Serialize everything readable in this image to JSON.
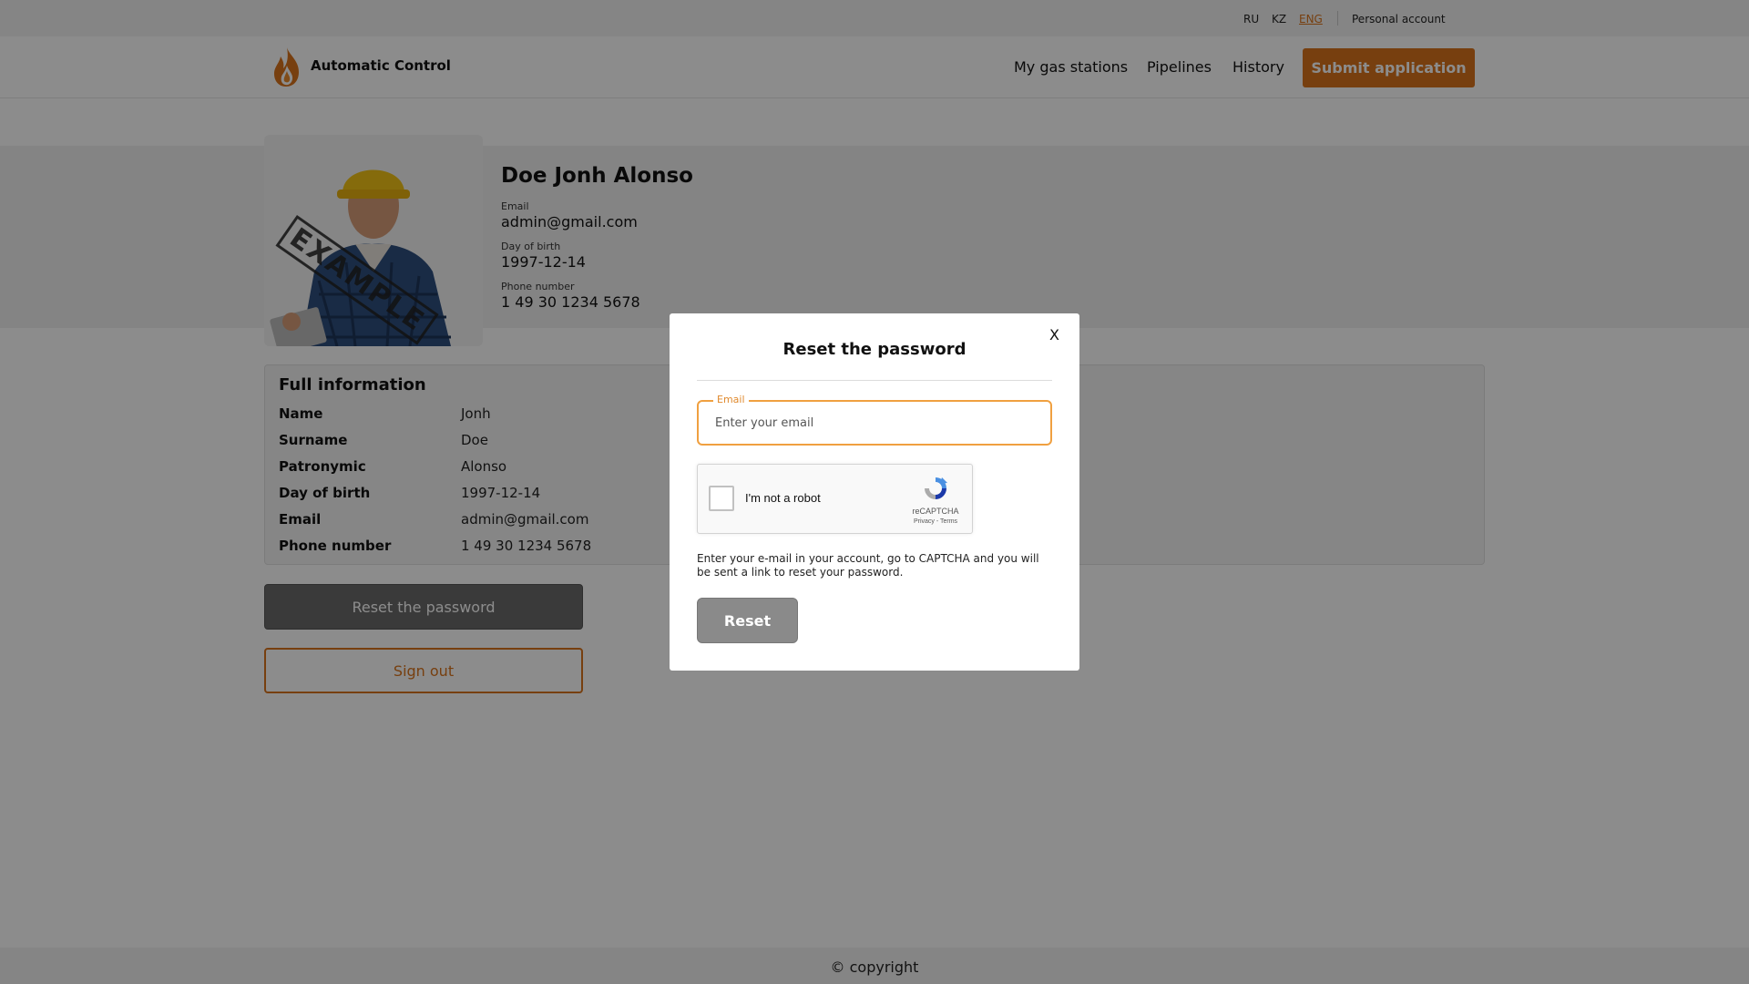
{
  "languages": [
    "RU",
    "KZ",
    "ENG"
  ],
  "active_language": "ENG",
  "header": {
    "personal_account": "Personal account",
    "logo_text": "Automatic Control",
    "nav": [
      "My gas stations",
      "Pipelines",
      "History"
    ],
    "submit_label": "Submit application"
  },
  "profile": {
    "name": "Doe Jonh Alonso",
    "photo_watermark": "EXAMPLE",
    "email_label": "Email",
    "email": "admin@gmail.com",
    "dob_label": "Day of birth",
    "dob": "1997-12-14",
    "phone_label": "Phone number",
    "phone": "1 49 30 1234 5678"
  },
  "full_info": {
    "title": "Full information",
    "rows": [
      {
        "label": "Name",
        "value": "Jonh"
      },
      {
        "label": "Surname",
        "value": "Doe"
      },
      {
        "label": "Patronymic",
        "value": "Alonso"
      },
      {
        "label": "Day of birth",
        "value": "1997-12-14"
      },
      {
        "label": "Email",
        "value": "admin@gmail.com"
      },
      {
        "label": "Phone number",
        "value": "1 49 30 1234 5678"
      }
    ]
  },
  "actions": {
    "reset_password": "Reset the password",
    "sign_out": "Sign out"
  },
  "footer": {
    "copyright": "© copyright"
  },
  "modal": {
    "close": "X",
    "title": "Reset the password",
    "email_legend": "Email",
    "email_placeholder": "Enter your email",
    "captcha_label": "I'm not a robot",
    "captcha_brand": "reCAPTCHA",
    "captcha_links": "Privacy - Terms",
    "help": "Enter your e-mail in your account, go to CAPTCHA and you will be sent a link to reset your password.",
    "reset_button": "Reset"
  },
  "colors": {
    "accent": "#d9741c",
    "overlay": "rgba(0,0,0,0.45)",
    "focus_border": "#f0a040"
  }
}
